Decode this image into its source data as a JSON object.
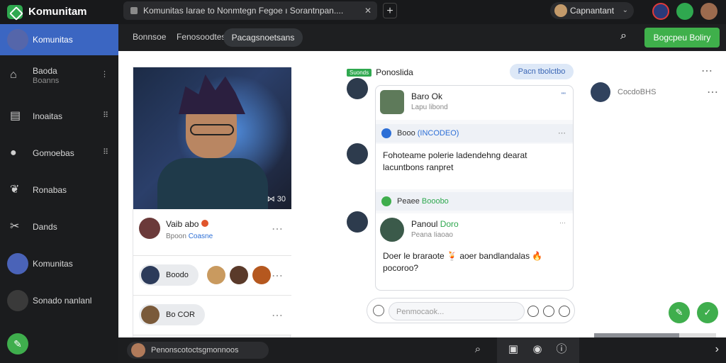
{
  "app": {
    "brand": "Komunitam"
  },
  "browser": {
    "tab_title": "Komunitas Iarae to Nonmtegn Fegoe ı Sorantnpan....",
    "tab_close": "✕",
    "new_tab": "+",
    "account_name": "Capnantant",
    "account_chevron": "⌄"
  },
  "sidebar": {
    "items": [
      {
        "label": "Komunitas",
        "active": true
      },
      {
        "label": "Baoda",
        "sub": "Boanns",
        "dots": "⋮"
      },
      {
        "label": "Inoaitas",
        "dots": "⠿"
      },
      {
        "label": "Gomoebas",
        "dots": "⠿"
      },
      {
        "label": "Ronabas"
      },
      {
        "label": "Dands"
      },
      {
        "label": "Komunitas"
      },
      {
        "label": "Sonado nanlanl"
      }
    ],
    "icons": [
      "home-icon",
      "doc-icon",
      "chat-icon",
      "apple-icon",
      "tools-icon"
    ],
    "fab_icon": "pencil-icon"
  },
  "subnav": {
    "links": [
      "Bonnsoe",
      "Fenosoodtes"
    ],
    "active_tab": "Pacagsnoetsans",
    "cta": "Bogcpeu Boliry"
  },
  "left_card": {
    "timer": "⋈ 30",
    "author": "Vaib abo",
    "author_sub_prefix": "Bpoon",
    "author_sub_link": "Coasne",
    "chip1": "Boodo",
    "chip2": "Bo COR",
    "dots": "⋯"
  },
  "feed": {
    "tag": "Suonds",
    "title": "Ponoslida",
    "filter_pill": "Pacn tbolctbo",
    "dots": "⋯",
    "msg1_name": "Baro Ok",
    "msg1_sub": "Lapu libond",
    "msg1_dots": "\"\"",
    "bar1_prefix": "Booo",
    "bar1_highlight": "(INCODEO)",
    "post_text": "Fohoteame polerie ladendehng dearat lacuntbons ranpret",
    "bar2_prefix": "Peaee",
    "bar2_highlight": "Booobo",
    "msg2_name": "Panoul",
    "msg2_name_hl": "Doro",
    "msg2_sub": "Peana Iiaoao",
    "msg2_text": "Doer le braraote 🍹 aoer bandlandalas 🔥 pocoroo?",
    "reply_placeholder": "Penmocaok..."
  },
  "right_panel": {
    "user": "CocdoBHS",
    "dots": "⋯",
    "fab1_icon": "edit-icon",
    "fab2_icon": "check-icon",
    "scroll_progress": 0.7
  },
  "bottombar": {
    "pill_label": "Penonscotoctsgmonnoos",
    "icons": [
      "search-icon",
      "image-icon",
      "camera-icon",
      "info-icon"
    ],
    "arrow": "›"
  },
  "colors": {
    "accent_green": "#3fae4d",
    "active_blue": "#3b66c2",
    "link_blue": "#2d6fd6"
  }
}
